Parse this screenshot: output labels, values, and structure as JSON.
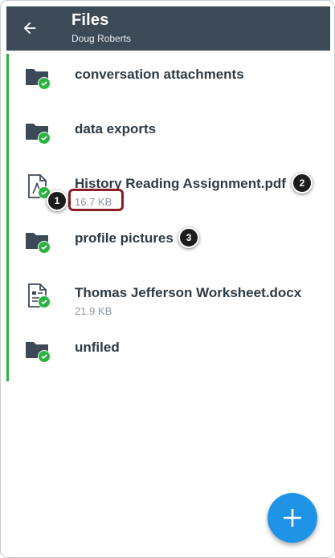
{
  "header": {
    "title": "Files",
    "subtitle": "Doug Roberts",
    "back_icon": "arrow-left-icon",
    "background": "#3c4a57"
  },
  "files": [
    {
      "name": "conversation attachments",
      "type": "folder",
      "size": "",
      "synced": true
    },
    {
      "name": "data exports",
      "type": "folder",
      "size": "",
      "synced": true
    },
    {
      "name": "History Reading Assignment.pdf",
      "type": "pdf",
      "size": "16.7 KB",
      "synced": true
    },
    {
      "name": "profile pictures",
      "type": "folder",
      "size": "",
      "synced": true
    },
    {
      "name": "Thomas Jefferson Worksheet.docx",
      "type": "document",
      "size": "21.9 KB",
      "synced": true
    },
    {
      "name": "unfiled",
      "type": "folder",
      "size": "",
      "synced": true
    }
  ],
  "callouts": {
    "one": "1",
    "two": "2",
    "three": "3"
  },
  "fab": {
    "icon": "plus-icon",
    "color": "#1f93e6"
  },
  "colors": {
    "sync_green": "#2ab340",
    "highlight": "#8b1d24"
  }
}
